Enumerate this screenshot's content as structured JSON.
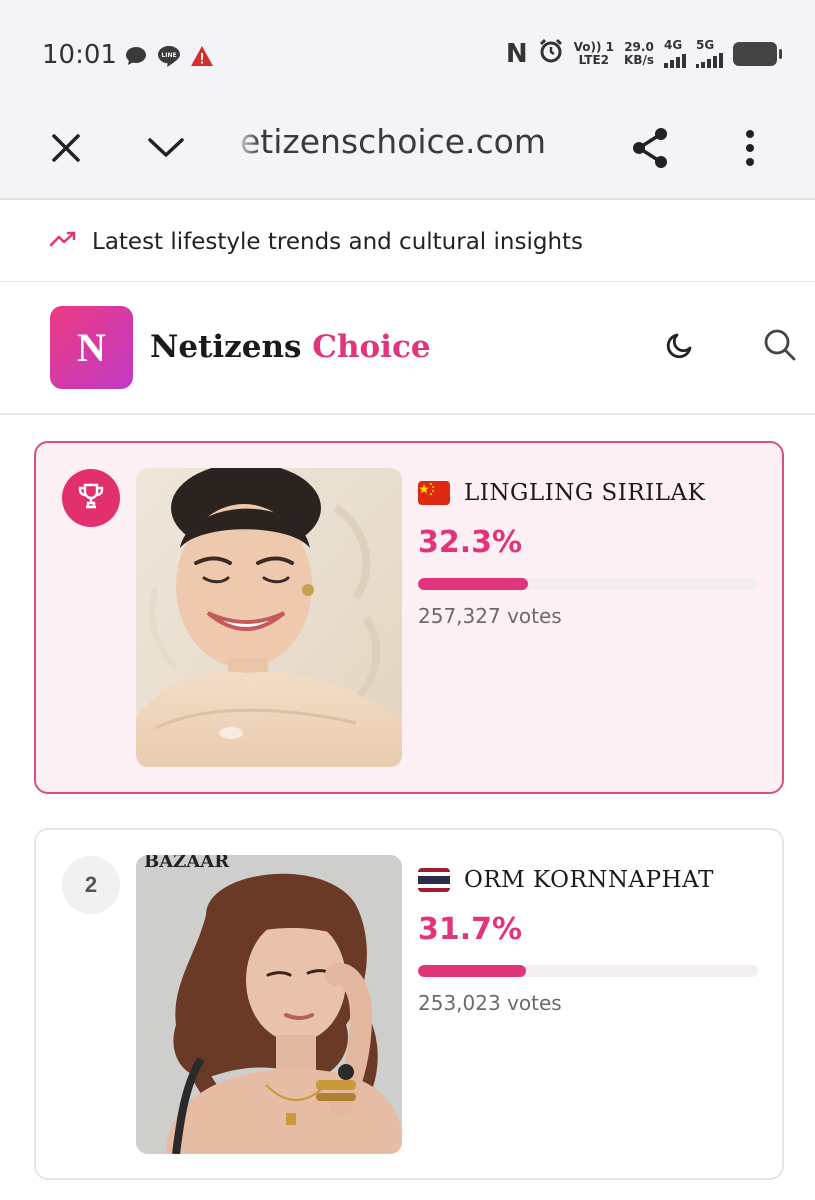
{
  "status_bar": {
    "time": "10:01",
    "net_speed_value": "29.0",
    "net_speed_unit": "KB/s",
    "volte_label": "Vo)) 1",
    "lte_label": "LTE2",
    "sim1_type": "4G",
    "sim2_type": "5G",
    "nfc_letter": "N"
  },
  "browser": {
    "url": "etizenschoice.com"
  },
  "trend_bar": {
    "text": "Latest lifestyle trends and cultural insights"
  },
  "site": {
    "logo_letter": "N",
    "name_part1": "Netizens",
    "name_part2": "Choice",
    "accent_color": "#e0357a"
  },
  "candidates": [
    {
      "rank": "1",
      "name": "LINGLING SIRILAK",
      "country_flag": "china-flag",
      "percent_text": "32.3%",
      "percent": 32.3,
      "votes": "257,327 votes",
      "highlighted": true
    },
    {
      "rank": "2",
      "name": "ORM KORNNAPHAT",
      "country_flag": "thailand-flag",
      "percent_text": "31.7%",
      "percent": 31.7,
      "votes": "253,023 votes",
      "highlighted": false,
      "photo_caption": "BAZAAR"
    }
  ]
}
